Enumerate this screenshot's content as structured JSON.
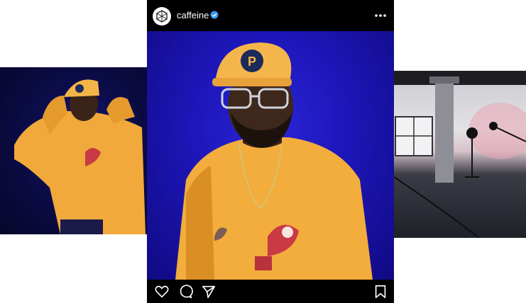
{
  "post": {
    "username": "caffeine",
    "verified": true,
    "icons": {
      "avatar": "caffeine-logo-icon",
      "verified": "verified-badge-icon",
      "more": "more-options-icon",
      "like": "heart-icon",
      "comment": "comment-icon",
      "share": "send-icon",
      "save": "bookmark-icon"
    }
  },
  "colors": {
    "accent_blue": "#1d16b8",
    "verified_blue": "#3897f0",
    "sweater_yellow": "#f2ad3c"
  }
}
